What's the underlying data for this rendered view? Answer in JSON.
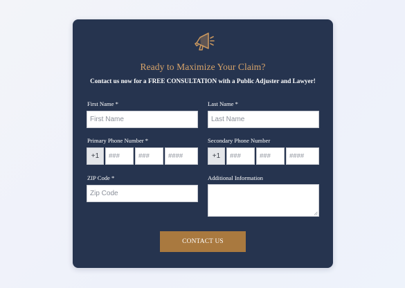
{
  "form": {
    "headline": "Ready to Maximize Your Claim?",
    "subheadline": "Contact us now for a FREE CONSULTATION with a Public Adjuster and Lawyer!",
    "first_name": {
      "label": "First Name *",
      "placeholder": "First Name"
    },
    "last_name": {
      "label": "Last Name *",
      "placeholder": "Last Name"
    },
    "primary_phone": {
      "label": "Primary Phone Number *",
      "country_code": "+1",
      "area_placeholder": "###",
      "prefix_placeholder": "###",
      "line_placeholder": "####"
    },
    "secondary_phone": {
      "label": "Secondary Phone Number",
      "country_code": "+1",
      "area_placeholder": "###",
      "prefix_placeholder": "###",
      "line_placeholder": "####"
    },
    "zip": {
      "label": "ZIP Code *",
      "placeholder": "Zip Code"
    },
    "additional_info": {
      "label": "Additional Information",
      "value": ""
    },
    "submit_label": "CONTACT US"
  },
  "colors": {
    "card_background": "#26344f",
    "headline": "#d8a46a",
    "button": "#a9793f",
    "page_background": "#edf0f8"
  },
  "icons": {
    "header_icon": "megaphone-icon"
  }
}
